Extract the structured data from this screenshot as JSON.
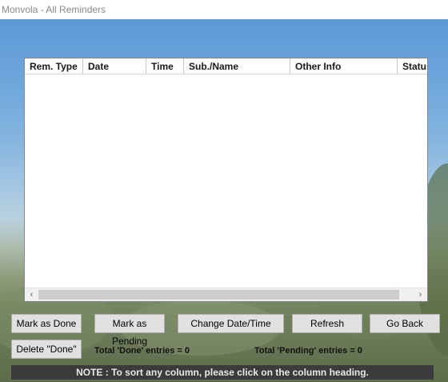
{
  "window": {
    "title": "Monvola - All Reminders"
  },
  "list": {
    "columns": [
      "Rem. Type",
      "Date",
      "Time",
      "Sub./Name",
      "Other Info",
      "Status"
    ],
    "rows": []
  },
  "buttons": {
    "mark_done": "Mark as Done",
    "mark_pending": "Mark as Pending",
    "change_datetime": "Change Date/Time",
    "refresh": "Refresh",
    "go_back": "Go Back",
    "delete_done": "Delete \"Done\""
  },
  "totals": {
    "done": "Total 'Done' entries = 0",
    "pending": "Total 'Pending' entries = 0"
  },
  "note": "NOTE : To sort any column, please click on the column heading.",
  "icons": {
    "scroll_left": "‹",
    "scroll_right": "›"
  }
}
